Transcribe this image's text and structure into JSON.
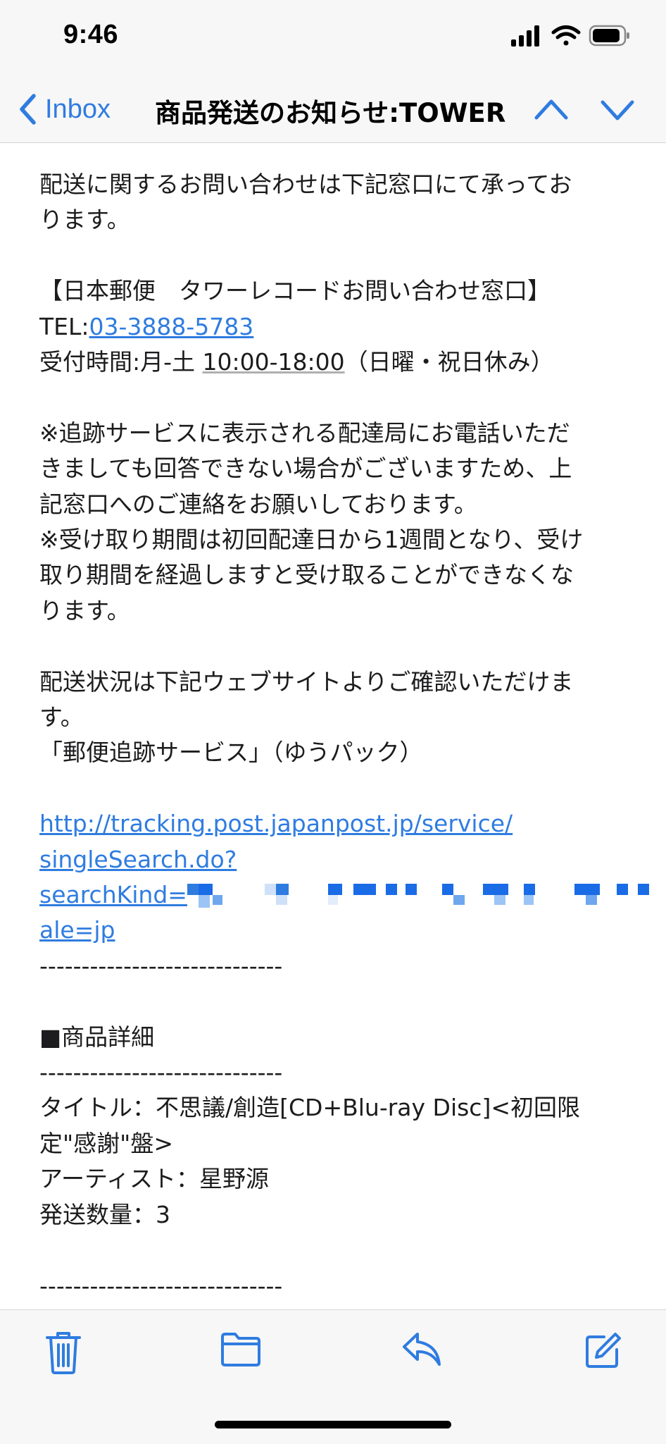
{
  "status_bar": {
    "time": "9:46"
  },
  "nav": {
    "back_label": "Inbox",
    "title": "商品発送のお知らせ:TOWER"
  },
  "body": {
    "p1_line1": "配送に関するお問い合わせは下記窓口にて承ってお",
    "p1_line2": "ります。",
    "contact_header": "【日本郵便　タワーレコードお問い合わせ窓口】",
    "tel_prefix": "TEL:",
    "tel_number": "03-3888-5783",
    "hours_prefix": "受付時間:月-土 ",
    "hours_time": "10:00-18:00",
    "hours_suffix": "（日曜・祝日休み）",
    "note1_line1": "※追跡サービスに表示される配達局にお電話いただ",
    "note1_line2": "きましても回答できない場合がございますため、上",
    "note1_line3": "記窓口へのご連絡をお願いしております。",
    "note2_line1": "※受け取り期間は初回配達日から1週間となり、受け",
    "note2_line2": "取り期間を経過しますと受け取ることができなくな",
    "note2_line3": "ります。",
    "status_line1": "配送状況は下記ウェブサイトよりご確認いただけま",
    "status_line2": "す。",
    "service_name": "「郵便追跡サービス」（ゆうパック）",
    "url_line1": "http://tracking.post.japanpost.jp/service/",
    "url_line2": "singleSearch.do?",
    "url_line3_prefix": "searchKind=",
    "url_line4": "ale=jp",
    "divider": "-----------------------------",
    "details_heading": "■商品詳細",
    "title_line1": "タイトル：不思議/創造[CD+Blu-ray Disc]<初回限",
    "title_line2": "定\"感謝\"盤>",
    "artist_line": "アーティスト：星野源",
    "quantity_line": "発送数量：3"
  },
  "colors": {
    "accent": "#2f7ce0",
    "bar_background": "#f7f7f7",
    "text": "#1c1c1e"
  },
  "icons": {
    "toolbar": [
      "trash-icon",
      "folder-icon",
      "reply-icon",
      "compose-icon"
    ],
    "nav": [
      "chevron-left-icon",
      "chevron-up-icon",
      "chevron-down-icon"
    ],
    "status": [
      "signal-icon",
      "wifi-icon",
      "battery-icon"
    ]
  }
}
